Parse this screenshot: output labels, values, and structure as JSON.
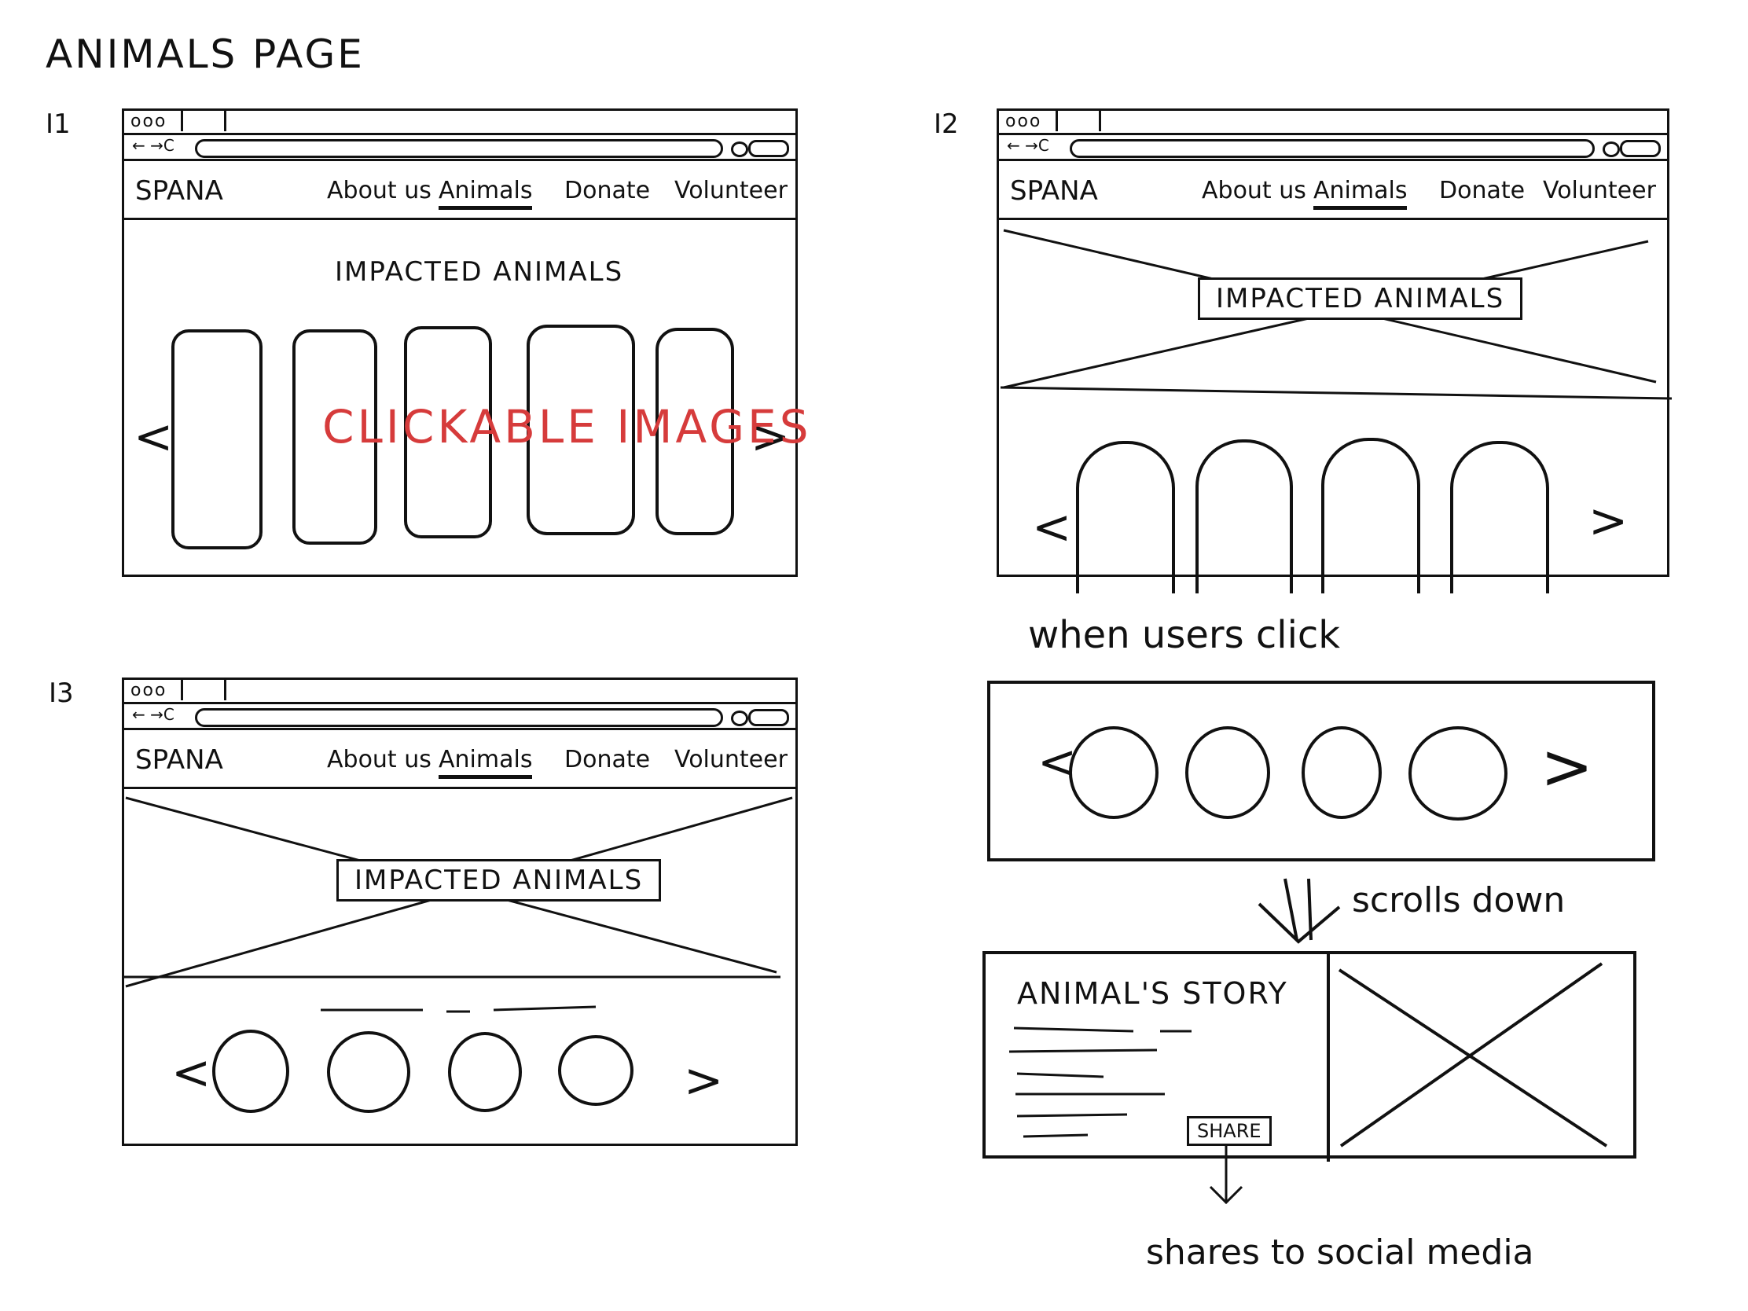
{
  "page_title": "ANIMALS PAGE",
  "iterations": [
    {
      "label": "I1"
    },
    {
      "label": "I2"
    },
    {
      "label": "I3"
    }
  ],
  "nav": {
    "logo": "SPANA",
    "items": [
      "About us",
      "Animals",
      "Donate",
      "Volunteer"
    ],
    "active": "Animals"
  },
  "i1": {
    "heading": "IMPACTED ANIMALS",
    "overlay_text": "CLICKABLE IMAGES"
  },
  "i2": {
    "hero_text": "IMPACTED ANIMALS"
  },
  "i3": {
    "hero_text": "IMPACTED ANIMALS"
  },
  "flow": {
    "when_click": "when users click",
    "scrolls": "scrolls down",
    "story_title": "ANIMAL'S STORY",
    "share": "SHARE",
    "shares_note": "shares to social media"
  },
  "browser_dots": "ooo",
  "browser_nav": "← →C",
  "arrows": {
    "prev": "<",
    "next": ">"
  }
}
